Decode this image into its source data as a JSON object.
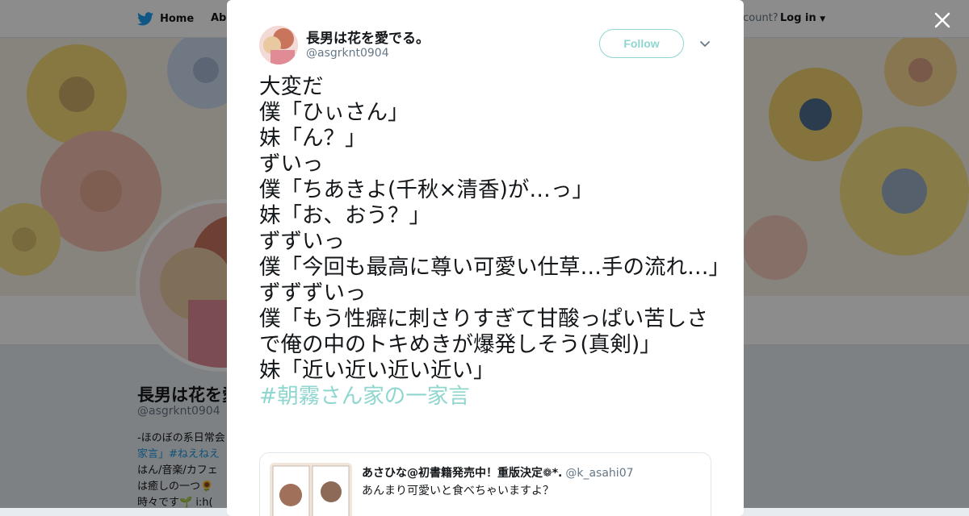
{
  "nav": {
    "home_label": "Home",
    "about_label": "Abo",
    "account_text": "account?",
    "login_label": "Log in"
  },
  "profile": {
    "name": "長男は花を愛",
    "handle": "@asgrknt0904",
    "bio_lines": [
      "-ほのぼの系日常会",
      "家言」#ねえねえ",
      "はん/音楽/カフェ",
      "は癒しの一つ🌻",
      "時々です🌱 i:h("
    ]
  },
  "tweet": {
    "author_name": "長男は花を愛でる。",
    "author_handle": "@asgrknt0904",
    "follow_label": "Follow",
    "lines": [
      "大変だ",
      "僕「ひぃさん」",
      "妹「ん？」",
      "ずいっ",
      "僕「ちあきよ(千秋×清香)が…っ」",
      "妹「お、おう？」",
      "ずずいっ",
      "僕「今回も最高に尊い可愛い仕草…手の流れ…」",
      "ずずずいっ",
      "僕「もう性癖に刺さりすぎて甘酸っぱい苦しさで俺の中のトキめきが爆発しそう(真剣)」",
      "妹「近い近い近い近い」"
    ],
    "hashtag": "#朝霧さん家の一家言"
  },
  "quoted": {
    "name": "あさひな@初書籍発売中！重版決定❁*.",
    "handle": "@k_asahi07",
    "text": "あんまり可愛いと食べちゃいますよ？"
  },
  "colors": {
    "accent": "#8fd6cf",
    "twitter_blue": "#1da1f2",
    "link_blue": "#1b95e0",
    "text": "#14171a",
    "muted": "#657786"
  },
  "icons": {
    "home": "twitter-bird-icon",
    "close": "close-icon",
    "menu": "chevron-down-icon"
  }
}
